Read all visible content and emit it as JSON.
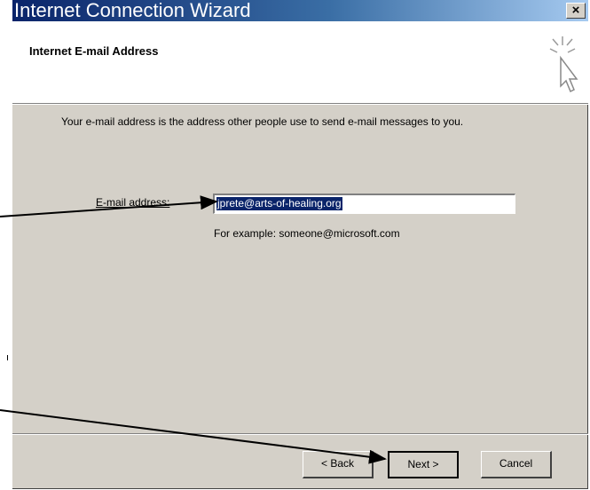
{
  "window": {
    "title": "Internet Connection Wizard",
    "close_label": "×"
  },
  "header": {
    "title": "Internet E-mail Address"
  },
  "body": {
    "description": "Your e-mail address is the address other people use to send e-mail messages to you.",
    "email_label": "E-mail address:",
    "email_value": "jprete@arts-of-healing.org",
    "example_text": "For example: someone@microsoft.com"
  },
  "buttons": {
    "back": "< Back",
    "next": "Next >",
    "cancel": "Cancel"
  },
  "icons": {
    "wizard": "wand-cursor-icon",
    "close": "close-icon"
  }
}
